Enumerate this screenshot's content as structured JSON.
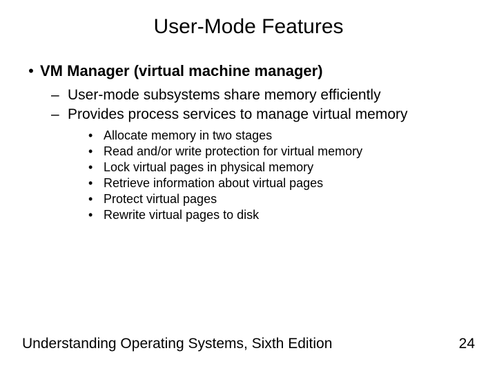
{
  "title": "User-Mode Features",
  "heading": "VM Manager (virtual machine manager)",
  "sub": {
    "a": "User-mode subsystems share memory efficiently",
    "b": "Provides process services to manage virtual memory"
  },
  "points": {
    "p1": "Allocate memory in two stages",
    "p2": "Read and/or write protection for virtual memory",
    "p3": "Lock virtual pages in physical memory",
    "p4": "Retrieve information about virtual pages",
    "p5": "Protect virtual pages",
    "p6": "Rewrite virtual pages to disk"
  },
  "footer": {
    "source": "Understanding Operating Systems, Sixth Edition",
    "page": "24"
  }
}
